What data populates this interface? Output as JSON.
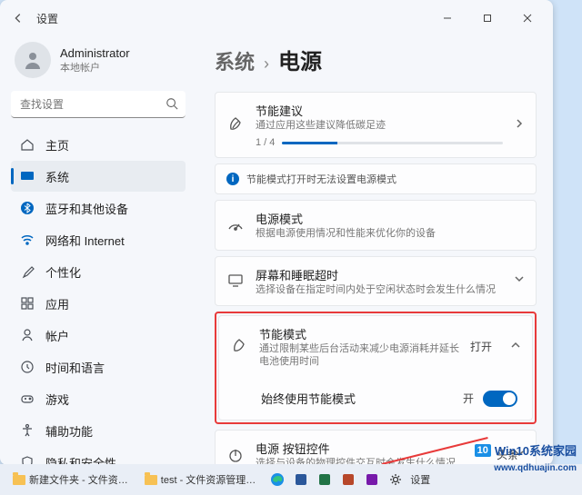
{
  "titlebar": {
    "title": "设置"
  },
  "user": {
    "name": "Administrator",
    "sub": "本地帐户"
  },
  "search": {
    "placeholder": "查找设置"
  },
  "nav": {
    "home": "主页",
    "system": "系统",
    "bluetooth": "蓝牙和其他设备",
    "network": "网络和 Internet",
    "personalization": "个性化",
    "apps": "应用",
    "accounts": "帐户",
    "time": "时间和语言",
    "gaming": "游戏",
    "accessibility": "辅助功能",
    "privacy": "隐私和安全性"
  },
  "breadcrumb": {
    "parent": "系统",
    "sep": "›",
    "current": "电源"
  },
  "cards": {
    "suggest": {
      "title": "节能建议",
      "sub": "通过应用这些建议降低碳足迹",
      "progress_label": "1 / 4"
    },
    "info": "节能模式打开时无法设置电源模式",
    "powermode": {
      "title": "电源模式",
      "sub": "根据电源使用情况和性能来优化你的设备"
    },
    "screen": {
      "title": "屏幕和睡眠超时",
      "sub": "选择设备在指定时间内处于空闲状态时会发生什么情况"
    },
    "saver": {
      "title": "节能模式",
      "sub": "通过限制某些后台活动来减少电源消耗并延长电池使用时间",
      "status": "打开",
      "toggle_label": "始终使用节能模式",
      "toggle_state": "开"
    },
    "buttons": {
      "title": "电源 按钮控件",
      "sub": "选择与设备的物理控件交互时会发生什么情况"
    }
  },
  "taskbar": {
    "item1": "新建文件夹 - 文件资…",
    "item2": "test - 文件资源管理…",
    "settings": "设置"
  },
  "watermark": {
    "tt": "头条",
    "brand": "Win10系统家园",
    "badge": "10",
    "url": "www.qdhuajin.com"
  }
}
